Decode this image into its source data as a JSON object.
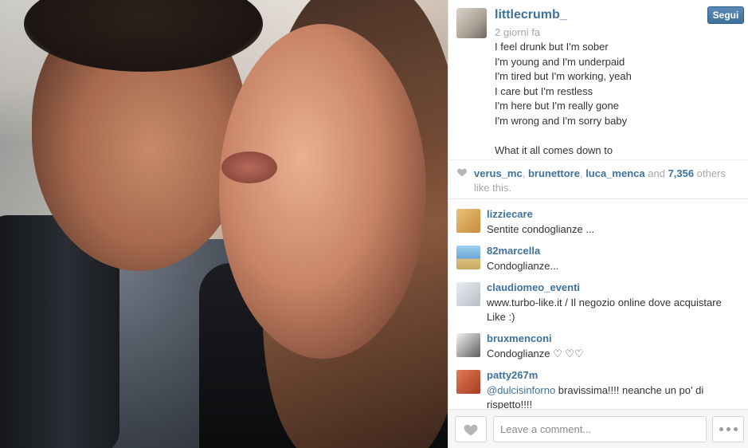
{
  "post": {
    "username": "littlecrumb_",
    "time": "2 giorni fa",
    "follow_label": "Segui",
    "caption": "I feel drunk but I'm sober\nI'm young and I'm underpaid\nI'm tired but I'm working, yeah\nI care but I'm restless\nI'm here but I'm really gone\nI'm wrong and I'm sorry baby\n\nWhat it all comes down to"
  },
  "likes": {
    "user1": "verus_mc",
    "user2": "brunettore",
    "user3": "luca_menca",
    "and": "and",
    "count": "7,356",
    "suffix": "others like this."
  },
  "comments": [
    {
      "user": "lizziecare",
      "text": "Sentite condoglianze ...",
      "avatar_color": "#d6a45b"
    },
    {
      "user": "82marcella",
      "text": "Condoglianze...",
      "avatar_color": "#6aa6d8"
    },
    {
      "user": "claudiomeo_eventi",
      "text": "www.turbo-like.it / Il negozio online dove acquistare Like :)",
      "avatar_color": "#c9cdd3"
    },
    {
      "user": "bruxmenconi",
      "text": "Condoglianze ♡ ♡♡",
      "avatar_color": "#6b6b6b"
    },
    {
      "user": "patty267m",
      "mention": "@dulcisinforno",
      "text": " bravissima!!!! neanche un po' di rispetto!!!!",
      "avatar_color": "#c8563a"
    },
    {
      "user": "patty267m",
      "text": "",
      "avatar_color": "#c8563a"
    }
  ],
  "composer": {
    "placeholder": "Leave a comment..."
  },
  "colors": {
    "link": "#3f729b",
    "muted": "#a5a7aa"
  },
  "icons": {
    "like": "heart-icon",
    "more": "ellipsis-icon"
  }
}
